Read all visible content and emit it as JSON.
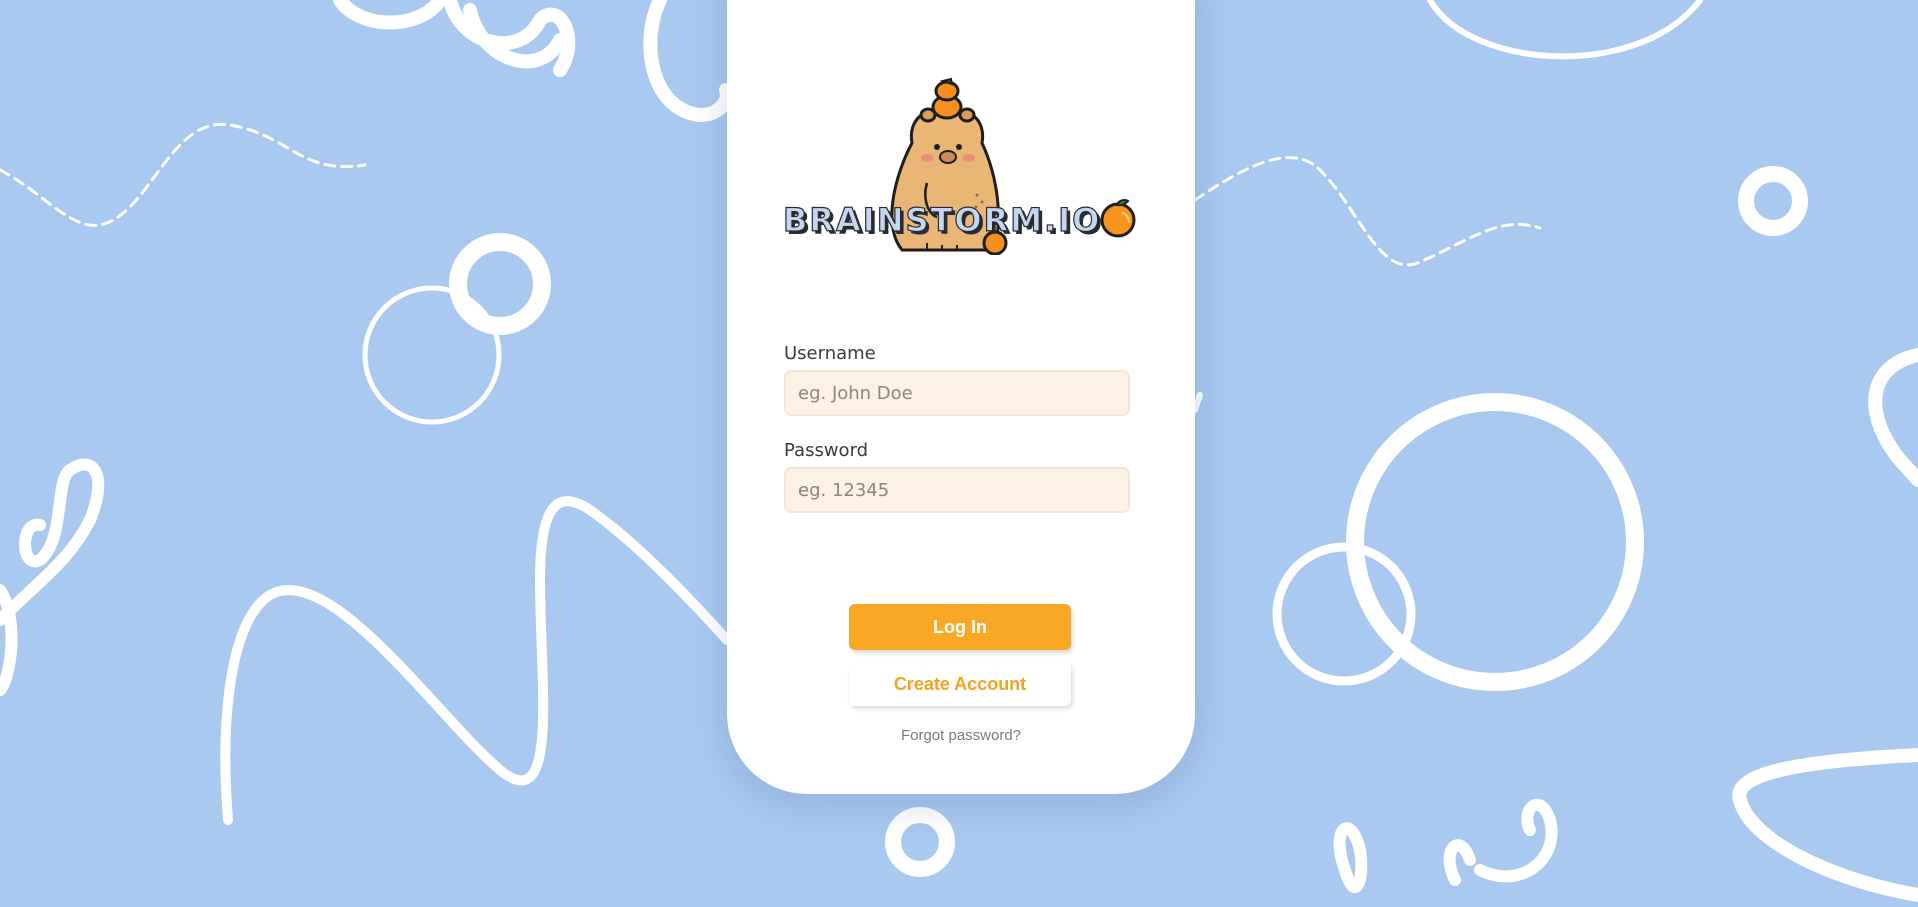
{
  "brand": {
    "name": "BRAINSTORM.IO"
  },
  "form": {
    "username_label": "Username",
    "username_placeholder": "eg. John Doe",
    "username_value": "",
    "password_label": "Password",
    "password_placeholder": "eg. 12345",
    "password_value": ""
  },
  "actions": {
    "login_label": "Log In",
    "create_label": "Create Account",
    "forgot_label": "Forgot password?"
  },
  "colors": {
    "background": "#a9c8f0",
    "accent": "#f9a825",
    "input_bg": "#fdf0e5",
    "card": "#ffffff"
  },
  "icons": {
    "mascot": "capybara-with-oranges-icon",
    "brand_orange": "orange-icon"
  }
}
